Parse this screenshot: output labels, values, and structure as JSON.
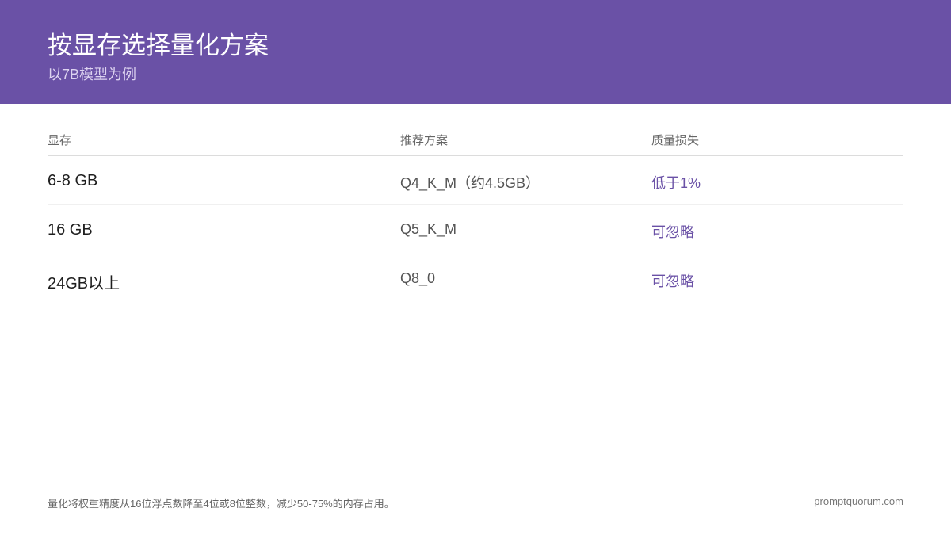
{
  "header": {
    "title": "按显存选择量化方案",
    "subtitle": "以7B模型为例",
    "bg_color": "#6a51a6"
  },
  "table": {
    "columns": [
      "显存",
      "推荐方案",
      "质量损失"
    ],
    "rows": [
      {
        "vram": "6-8 GB",
        "scheme": "Q4_K_M（约4.5GB）",
        "loss": "低于1%"
      },
      {
        "vram": "16 GB",
        "scheme": "Q5_K_M",
        "loss": "可忽略"
      },
      {
        "vram": "24GB以上",
        "scheme": "Q8_0",
        "loss": "可忽略"
      }
    ],
    "accent_color": "#6a51a6"
  },
  "footer": {
    "note": "量化将权重精度从16位浮点数降至4位或8位整数，减少50-75%的内存占用。",
    "brand": "promptquorum.com"
  }
}
